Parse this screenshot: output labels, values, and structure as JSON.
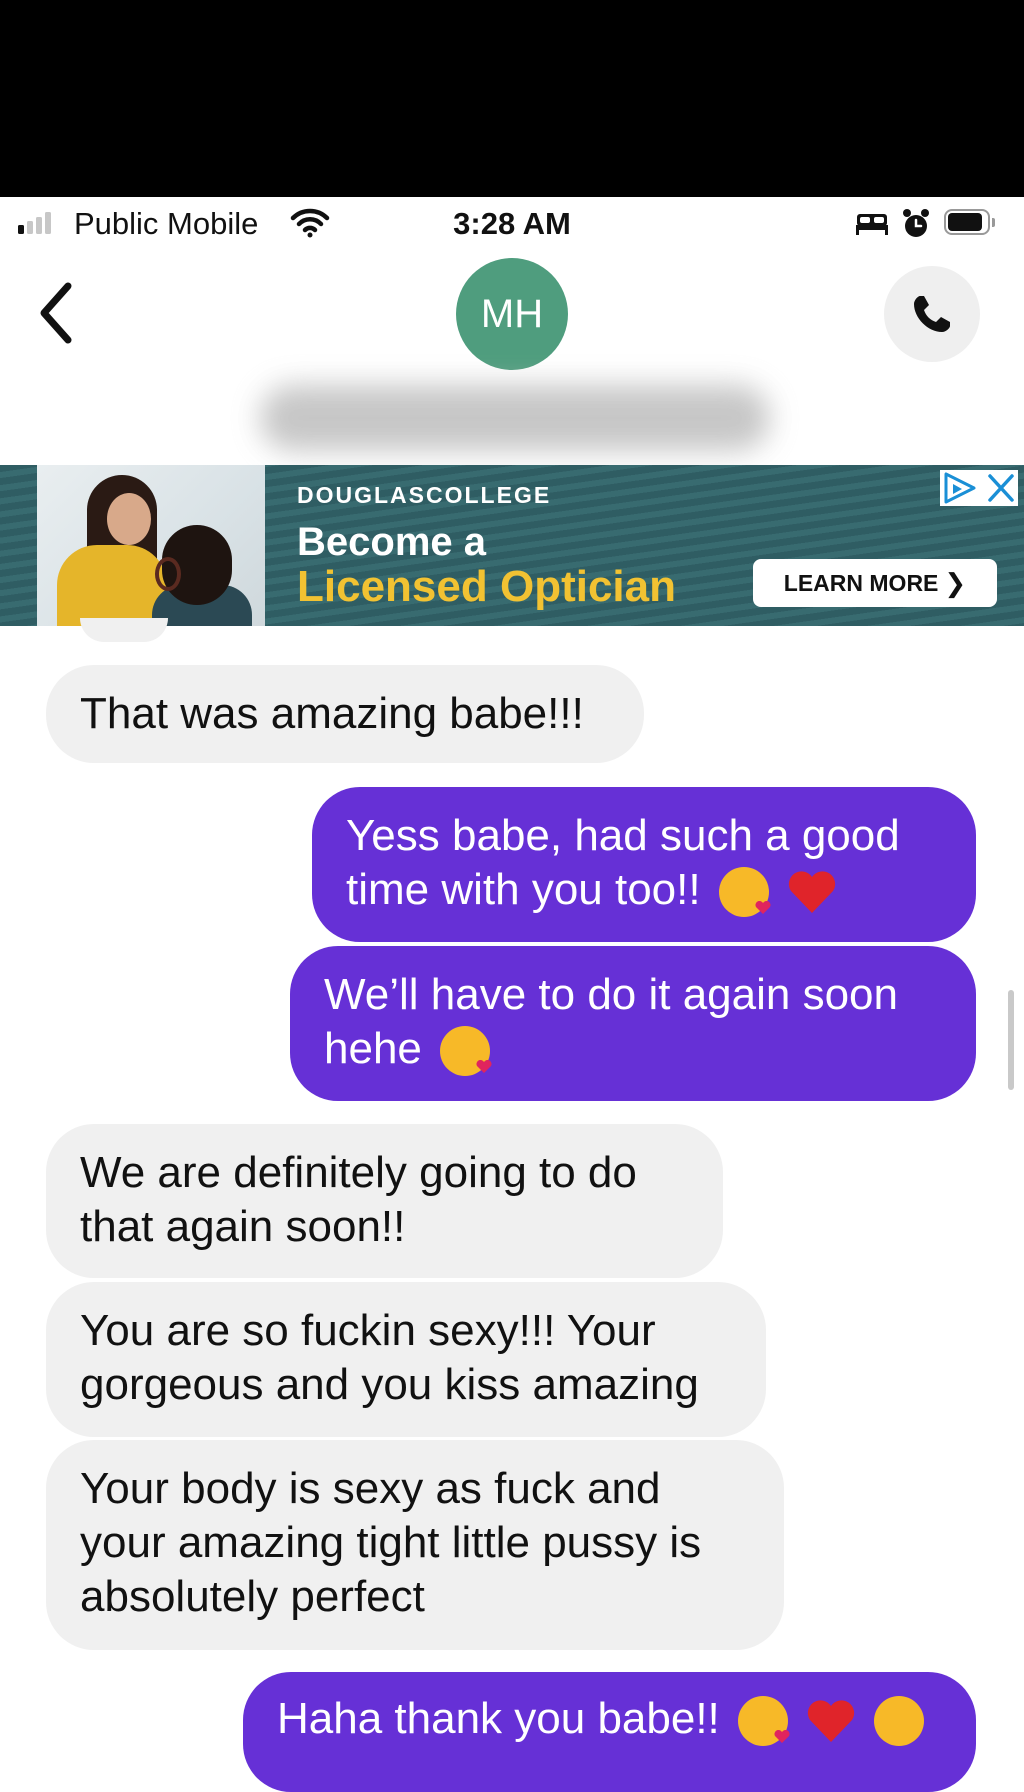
{
  "status_bar": {
    "carrier": "Public Mobile",
    "time": "3:28 AM",
    "battery_level": 0.9,
    "icons": [
      "signal-icon",
      "wifi-icon",
      "bed-icon",
      "alarm-icon",
      "battery-icon"
    ]
  },
  "header": {
    "avatar_initials": "MH",
    "avatar_color": "#4f9d7e",
    "contact_name": "",
    "icons": [
      "back-chevron-icon",
      "phone-icon"
    ]
  },
  "ad": {
    "brand": "DOUGLASCOLLEGE",
    "headline_line1": "Become a",
    "headline_line2": "Licensed Optician",
    "cta": "LEARN MORE",
    "icons": [
      "ad-choices-icon",
      "ad-close-icon",
      "chevron-right-icon"
    ]
  },
  "colors": {
    "outgoing_bubble": "#6630d6",
    "incoming_bubble": "#f0f0f0",
    "ad_highlight": "#f2c232"
  },
  "messages": [
    {
      "direction": "incoming",
      "text": "That was amazing babe!!!"
    },
    {
      "direction": "outgoing",
      "text": "Yess babe, had such a good time with you too!!",
      "emojis": [
        "kissing-heart-emoji",
        "red-heart-emoji"
      ]
    },
    {
      "direction": "outgoing",
      "text": "We’ll have to do it again soon hehe",
      "emojis": [
        "kissing-heart-emoji"
      ]
    },
    {
      "direction": "incoming",
      "text": "We are definitely going to do that again soon!!"
    },
    {
      "direction": "incoming",
      "text": "You are so fuckin sexy!!! Your gorgeous and you kiss amazing"
    },
    {
      "direction": "incoming",
      "text": "Your body is sexy as fuck and your amazing tight little pussy is absolutely perfect"
    },
    {
      "direction": "outgoing",
      "text": "Haha thank you babe!!",
      "emojis": [
        "kissing-heart-emoji",
        "red-heart-emoji",
        "smiling-hearts-emoji"
      ]
    }
  ]
}
